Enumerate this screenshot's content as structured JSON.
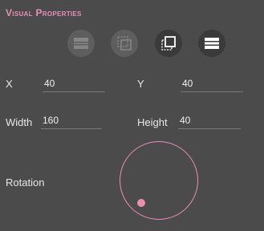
{
  "panel": {
    "title": "Visual Properties"
  },
  "toolbar": {
    "buttons": [
      {
        "icon": "align-lines-icon",
        "active": false
      },
      {
        "icon": "dotted-frame-icon",
        "active": false
      },
      {
        "icon": "layer-front-icon",
        "active": true
      },
      {
        "icon": "align-lines-bold-icon",
        "active": true
      }
    ]
  },
  "fields": {
    "x": {
      "label": "X",
      "value": "40"
    },
    "y": {
      "label": "Y",
      "value": "40"
    },
    "width": {
      "label": "Width",
      "value": "160"
    },
    "height": {
      "label": "Height",
      "value": "40"
    }
  },
  "rotation": {
    "label": "Rotation"
  },
  "colors": {
    "accent": "#e88fb3",
    "background": "#4b4b4b",
    "button": "#5e5e5e",
    "button_active": "#3a3a3a"
  }
}
